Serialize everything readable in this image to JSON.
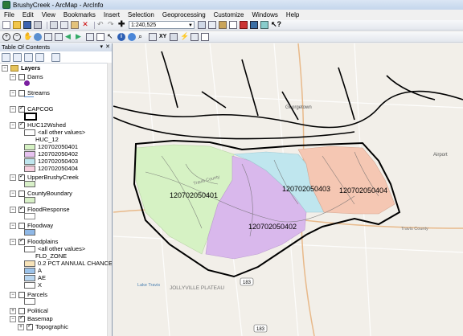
{
  "window": {
    "title": "BrushyCreek - ArcMap - ArcInfo"
  },
  "menu": [
    "File",
    "Edit",
    "View",
    "Bookmarks",
    "Insert",
    "Selection",
    "Geoprocessing",
    "Customize",
    "Windows",
    "Help"
  ],
  "toolbar": {
    "scale": "1:240,525"
  },
  "toc": {
    "title": "Table Of Contents",
    "root": "Layers",
    "items": {
      "dams": "Dams",
      "streams": "Streams",
      "capcog": "CAPCOG",
      "huc": "HUC12Wshed",
      "huc_other": "<all other values>",
      "huc_field": "HUC_12",
      "huc_vals": [
        "120702050401",
        "120702050402",
        "120702050403",
        "120702050404"
      ],
      "upper": "UpperBrushyCreek",
      "county": "CountyBoundary",
      "floodresp": "FloodResponse",
      "floodway": "Floodway",
      "floodplains": "Floodplains",
      "fp_other": "<all other values>",
      "fp_field": "FLD_ZONE",
      "fp_vals": [
        "0.2 PCT ANNUAL CHANCE FLOOD",
        "A",
        "AE",
        "X"
      ],
      "parcels": "Parcels",
      "political": "Political",
      "basemap": "Basemap",
      "topographic": "Topographic"
    }
  },
  "map": {
    "labels": [
      "120702050401",
      "120702050402",
      "120702050403",
      "120702050404"
    ],
    "places": [
      "Georgetown",
      "Airport",
      "Travis County",
      "Travis County",
      "JOLLYVILLE PLATEAU",
      "183",
      "183",
      "Lake Travis"
    ],
    "colors": {
      "w401": "#d6f2c4",
      "w402": "#d9b8ec",
      "w403": "#bfe6ee",
      "w404": "#f5c7b3",
      "background": "#f2efe9"
    }
  }
}
